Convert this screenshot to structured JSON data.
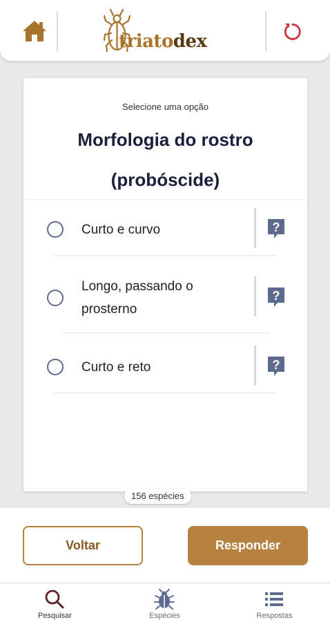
{
  "header": {
    "logo_part1": "triato",
    "logo_part2": "dex"
  },
  "question": {
    "subtitle": "Selecione uma opção",
    "title_line1": "Morfologia do rostro",
    "title_line2": "(probóscide)"
  },
  "options": [
    {
      "label_line1": "Curto e curvo",
      "label_line2": ""
    },
    {
      "label_line1": "Longo, passando o",
      "label_line2": "prosterno"
    },
    {
      "label_line1": "Curto e reto",
      "label_line2": ""
    }
  ],
  "species_count": "156 espécies",
  "actions": {
    "back_label": "Voltar",
    "answer_label": "Responder"
  },
  "nav": {
    "search_label": "Pesquisar",
    "species_label": "Espécies",
    "answers_label": "Respostas"
  },
  "colors": {
    "brand": "#b5833f",
    "brand_dark": "#5a3a12",
    "refresh": "#d0313c",
    "help": "#5d6a8f"
  },
  "icons": {
    "home": "home-icon",
    "refresh": "refresh-icon",
    "help": "help-icon",
    "search": "search-icon",
    "species": "bug-icon",
    "answers": "list-icon"
  }
}
